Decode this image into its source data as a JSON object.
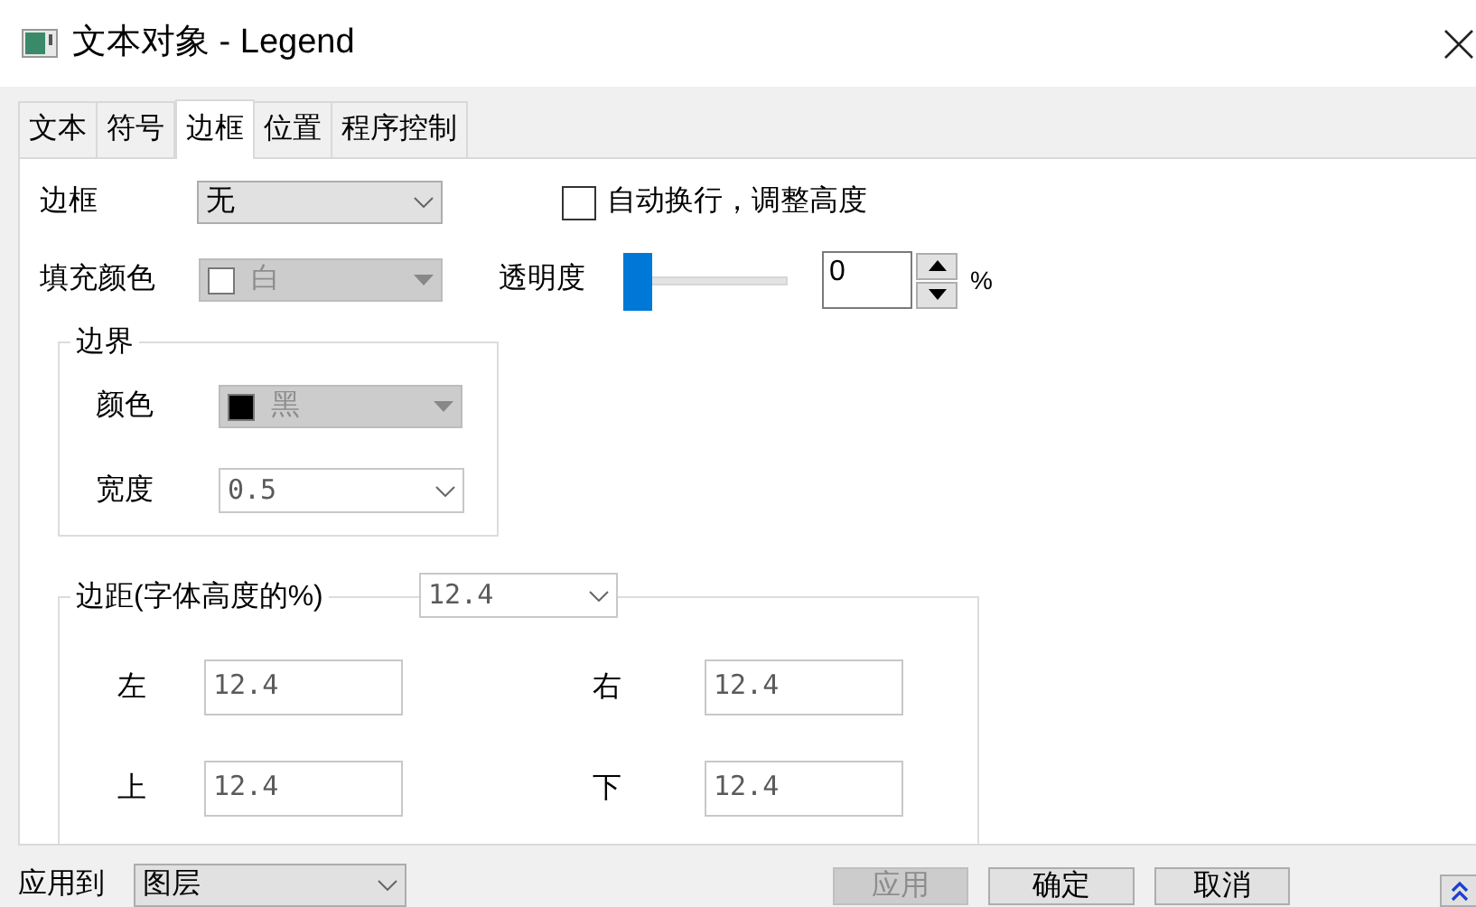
{
  "window": {
    "title": "文本对象 - Legend"
  },
  "tabs": [
    {
      "label": "文本",
      "selected": false
    },
    {
      "label": "符号",
      "selected": false
    },
    {
      "label": "边框",
      "selected": true
    },
    {
      "label": "位置",
      "selected": false
    },
    {
      "label": "程序控制",
      "selected": false
    }
  ],
  "border": {
    "label": "边框",
    "value": "无"
  },
  "auto_wrap": {
    "label": "自动换行，调整高度",
    "checked": false
  },
  "fill_color": {
    "label": "填充颜色",
    "value": "白",
    "color": "#ffffff",
    "disabled": true
  },
  "transparency": {
    "label": "透明度",
    "level": 0,
    "value": "0",
    "unit": "%"
  },
  "boundary": {
    "title": "边界",
    "color": {
      "label": "颜色",
      "value": "黑",
      "color": "#000000",
      "disabled": true
    },
    "width": {
      "label": "宽度",
      "value": "0.5"
    }
  },
  "margins": {
    "title": "边距(字体高度的%)",
    "value": "12.4",
    "fields": [
      {
        "label": "左",
        "value": "12.4"
      },
      {
        "label": "右",
        "value": "12.4"
      },
      {
        "label": "上",
        "value": "12.4"
      },
      {
        "label": "下",
        "value": "12.4"
      }
    ]
  },
  "apply_to": {
    "label": "应用到",
    "value": "图层"
  },
  "buttons": [
    {
      "label": "应用",
      "disabled": true
    },
    {
      "label": "确定",
      "disabled": false
    },
    {
      "label": "取消",
      "disabled": false
    }
  ]
}
